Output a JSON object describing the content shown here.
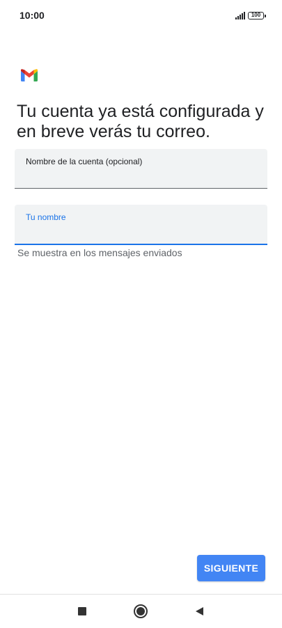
{
  "status_bar": {
    "time": "10:00",
    "battery": "100",
    "icons": [
      "signal-icon",
      "battery-icon"
    ]
  },
  "app": {
    "logo": "gmail-logo-icon",
    "colors": {
      "blue": "#4285f4",
      "red": "#ea4335",
      "yellow": "#fbbc04",
      "green": "#34a853",
      "accent": "#1a73e8"
    }
  },
  "main": {
    "title": "Tu cuenta ya está configurada y en breve verás tu correo.",
    "account_field": {
      "label": "Nombre de la cuenta (opcional)",
      "value": "",
      "placeholder": ""
    },
    "name_field": {
      "label": "Tu nombre",
      "value": "",
      "placeholder": ""
    },
    "helper": "Se muestra en los mensajes enviados",
    "next_label": "SIGUIENTE"
  },
  "nav_bar": {
    "icons": [
      "recents-icon",
      "home-icon",
      "back-icon"
    ]
  }
}
